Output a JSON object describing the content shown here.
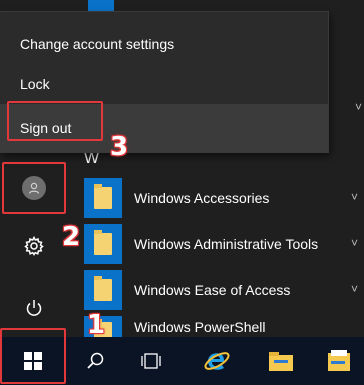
{
  "account_menu": {
    "items": [
      {
        "label": "Change account settings"
      },
      {
        "label": "Lock"
      },
      {
        "label": "Sign out"
      }
    ]
  },
  "app_list": {
    "section_letter": "W",
    "apps": [
      {
        "label": "Windows Accessories",
        "icon": "folder-icon"
      },
      {
        "label": "Windows Administrative Tools",
        "icon": "folder-icon"
      },
      {
        "label": "Windows Ease of Access",
        "icon": "folder-icon"
      },
      {
        "label": "Windows PowerShell",
        "icon": "folder-icon"
      }
    ],
    "expand_glyph": "˅"
  },
  "left_rail": {
    "items": [
      "user-avatar",
      "settings-gear-icon",
      "power-icon"
    ]
  },
  "taskbar": {
    "items": [
      "start-button",
      "search-icon",
      "task-view-icon",
      "internet-explorer-icon",
      "file-explorer-icon",
      "file-explorer-extra-icon"
    ]
  },
  "annotations": {
    "step1": "1",
    "step2": "2",
    "step3": "3",
    "highlight_color": "#e2383c"
  },
  "colors": {
    "accent": "#0a72c8",
    "menu_bg": "#1f1f1f",
    "flyout_bg": "#2b2b2b",
    "taskbar_bg": "#0a1424"
  }
}
